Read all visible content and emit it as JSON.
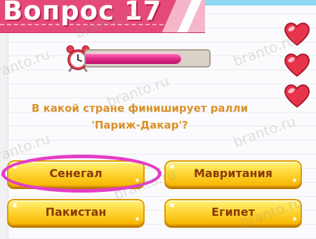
{
  "header": {
    "title": "Вопрос 17"
  },
  "timer": {
    "remaining_fraction": 0.77,
    "fill_color": "#e0288a"
  },
  "lives": {
    "count": 3,
    "heart_color": "#e8344a"
  },
  "question": {
    "line1": "В какой стране финиширует ралли",
    "line2": "'Париж-Дакар'?"
  },
  "answers": [
    {
      "label": "Сенегал",
      "highlighted": true
    },
    {
      "label": "Мавритания",
      "highlighted": false
    },
    {
      "label": "Пакистан",
      "highlighted": false
    },
    {
      "label": "Египет",
      "highlighted": false
    }
  ],
  "watermarks": [
    "branto.ru",
    "branto.ru",
    "branto.ru",
    "branto.ru",
    "branto.ru",
    "branto.ru",
    "branto.ru",
    "branto.ru"
  ],
  "colors": {
    "banner": "#e5497a",
    "question_text": "#d99128",
    "answer_text": "#8a3b08",
    "highlight": "#e43cc8"
  }
}
